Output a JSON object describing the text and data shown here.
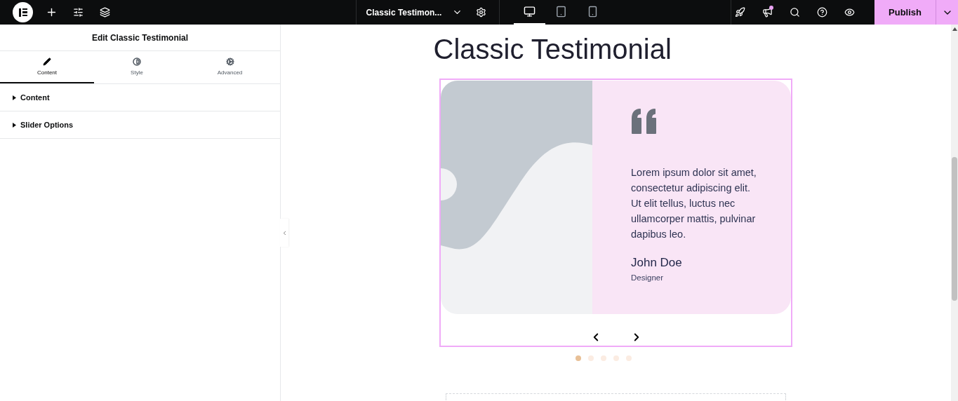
{
  "topbar": {
    "document_title": "Classic Testimon...",
    "publish": "Publish",
    "devices": [
      {
        "selected": true
      },
      {
        "selected": false
      },
      {
        "selected": false
      }
    ],
    "whats_new_unread": true
  },
  "panel": {
    "title": "Edit Classic Testimonial",
    "tabs": [
      {
        "label": "Content",
        "selected": true
      },
      {
        "label": "Style",
        "selected": false
      },
      {
        "label": "Advanced",
        "selected": false
      }
    ],
    "sections": [
      {
        "label": "Content",
        "expanded": false
      },
      {
        "label": "Slider Options",
        "expanded": false
      }
    ]
  },
  "page": {
    "heading": "Classic Testimonial",
    "testimonial": {
      "kind": "picture",
      "quote": "Lorem ipsum dolor sit amet, consectetur adipiscing elit. Ut elit tellus, luctus nec ullamcorper mattis, pulvinar dapibus leo.",
      "name": "John Doe",
      "role": "Designer"
    },
    "dots": [
      {
        "selected": true
      },
      {
        "selected": false
      },
      {
        "selected": false
      },
      {
        "selected": false
      },
      {
        "selected": false
      }
    ]
  }
}
